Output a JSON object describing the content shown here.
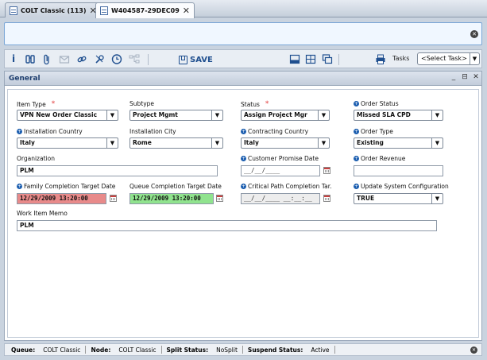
{
  "tabs": [
    {
      "label": "COLT Classic (113)",
      "icon": "list-icon",
      "close": "✕"
    },
    {
      "label": "W404587-29DEC09",
      "icon": "document-icon",
      "close": "✕"
    }
  ],
  "message_close": "✕",
  "toolbar": {
    "icons": [
      "info-icon",
      "binoculars-icon",
      "attachment-icon",
      "email-icon",
      "link-icon",
      "tools-icon",
      "clock-icon",
      "hierarchy-icon"
    ],
    "save_label": "SAVE",
    "layout_icons": [
      "layout-single-icon",
      "layout-grid-icon",
      "layout-stack-icon"
    ],
    "print_icon": "print-icon",
    "tasks_label": "Tasks",
    "tasks_select": "<Select Task>"
  },
  "panel": {
    "title": "General",
    "controls": [
      "_",
      "⊟",
      "✕"
    ]
  },
  "form": {
    "item_type": {
      "label": "Item Type",
      "required": "*",
      "value": "VPN New Order Classic"
    },
    "subtype": {
      "label": "Subtype",
      "value": "Project Mgmt"
    },
    "status": {
      "label": "Status",
      "required": "*",
      "value": "Assign Project Mgr"
    },
    "order_status": {
      "label": "Order Status",
      "value": "Missed SLA CPD"
    },
    "installation_country": {
      "label": "Installation Country",
      "value": "Italy"
    },
    "installation_city": {
      "label": "Installation City",
      "value": "Rome"
    },
    "contracting_country": {
      "label": "Contracting Country",
      "value": "Italy"
    },
    "order_type": {
      "label": "Order Type",
      "value": "Existing"
    },
    "organization": {
      "label": "Organization",
      "value": "PLM"
    },
    "customer_promise_date": {
      "label": "Customer Promise Date",
      "value": "__/__/____"
    },
    "order_revenue": {
      "label": "Order Revenue",
      "value": ""
    },
    "family_completion": {
      "label": "Family Completion Target Date",
      "value": "12/29/2009 13:20:00"
    },
    "queue_completion": {
      "label": "Queue Completion Target Date",
      "value": "12/29/2009 13:20:00"
    },
    "critical_path": {
      "label": "Critical Path Completion Tar.",
      "value": "__/__/____ __:__:__"
    },
    "update_system_config": {
      "label": "Update System Configuration",
      "value": "TRUE"
    },
    "work_item_memo": {
      "label": "Work Item Memo",
      "value": "PLM"
    }
  },
  "colors": {
    "overdue_date": "#e88a8a",
    "ok_date": "#90e38e",
    "accent": "#1f4f8f"
  },
  "statusbar": {
    "queue_label": "Queue:",
    "queue_value": "COLT Classic",
    "node_label": "Node:",
    "node_value": "COLT Classic",
    "split_label": "Split Status:",
    "split_value": "NoSplit",
    "suspend_label": "Suspend Status:",
    "suspend_value": "Active",
    "close": "✕"
  }
}
